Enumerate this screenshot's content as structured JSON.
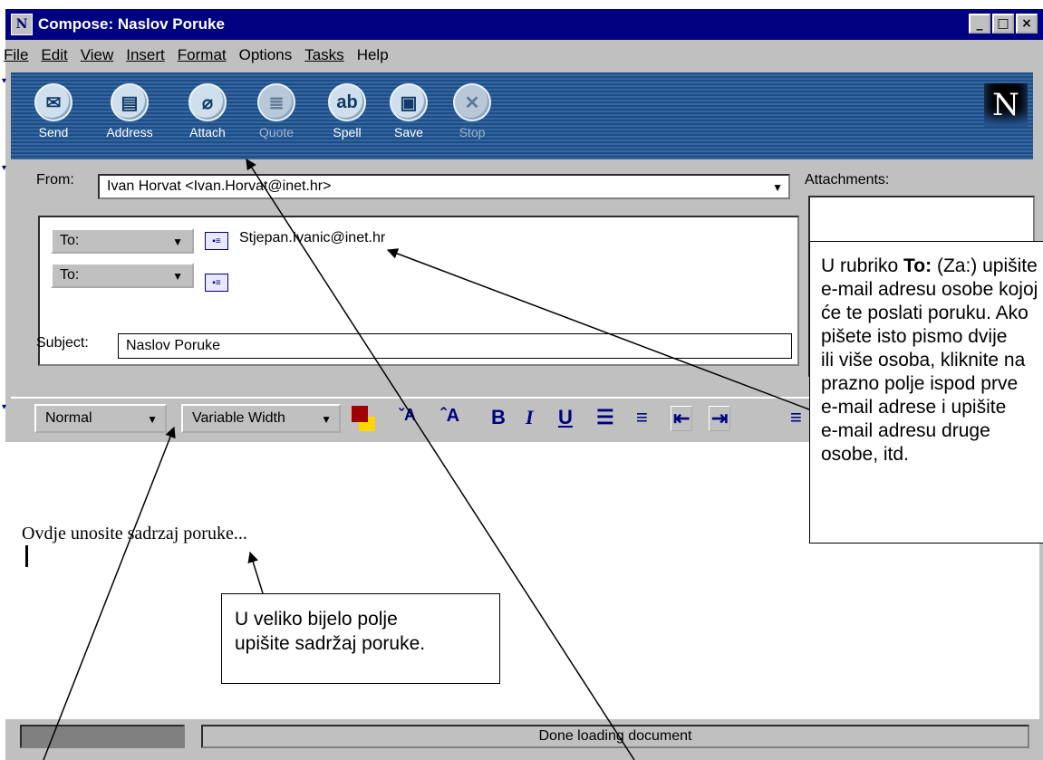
{
  "window": {
    "title": "Compose: Naslov Poruke",
    "app_icon": "N",
    "controls": {
      "minimize": "_",
      "maximize": "□",
      "close": "×"
    }
  },
  "menu": {
    "items": [
      {
        "label": "File",
        "underline": "F"
      },
      {
        "label": "Edit",
        "underline": "E"
      },
      {
        "label": "View",
        "underline": "V"
      },
      {
        "label": "Insert",
        "underline": "I"
      },
      {
        "label": "Format",
        "underline": "o"
      },
      {
        "label": "Options",
        "underline": ""
      },
      {
        "label": "Tasks",
        "underline": "T"
      },
      {
        "label": "Help",
        "underline": ""
      }
    ]
  },
  "toolbar": {
    "buttons": [
      {
        "label": "Send",
        "icon": "send-icon",
        "glyph": "✉",
        "enabled": true
      },
      {
        "label": "Address",
        "icon": "address-book-icon",
        "glyph": "▤",
        "enabled": true
      },
      {
        "label": "Attach",
        "icon": "paperclip-icon",
        "glyph": "⌀",
        "enabled": true
      },
      {
        "label": "Quote",
        "icon": "quote-icon",
        "glyph": "≣",
        "enabled": false
      },
      {
        "label": "Spell",
        "icon": "spell-check-icon",
        "glyph": "ab",
        "enabled": true
      },
      {
        "label": "Save",
        "icon": "save-icon",
        "glyph": "▣",
        "enabled": true
      },
      {
        "label": "Stop",
        "icon": "stop-icon",
        "glyph": "✕",
        "enabled": false
      }
    ],
    "logo": "N"
  },
  "address": {
    "from_label": "From:",
    "from_value": "Ivan Horvat <Ivan.Horvat@inet.hr>",
    "recipients": [
      {
        "type": "To:",
        "address": "Stjepan.Ivanic@inet.hr"
      },
      {
        "type": "To:",
        "address": ""
      }
    ],
    "subject_label": "Subject:",
    "subject_value": "Naslov Poruke",
    "attachments_label": "Attachments:"
  },
  "format_bar": {
    "paragraph_style": "Normal",
    "font": "Variable Width",
    "text_color": "#a00000",
    "bg_color": "#ffd700"
  },
  "editor": {
    "body": "Ovdje unosite sadrzaj poruke..."
  },
  "status": {
    "text": "Done loading document"
  },
  "callouts": {
    "right": {
      "lead": "U rubriko ",
      "bold": "To:",
      "rest_lines": [
        " (Za:) upišite",
        "e-mail adresu osobe kojoj",
        "će te poslati poruku. Ako",
        "pišete isto pismo dvije",
        "ili više osoba, kliknite na",
        "prazno polje ispod prve",
        "e-mail adrese i upišite",
        "e-mail adresu druge",
        "osobe, itd."
      ]
    },
    "bottom": {
      "line1": "U veliko bijelo polje",
      "line2": "upišite sadržaj poruke."
    }
  }
}
